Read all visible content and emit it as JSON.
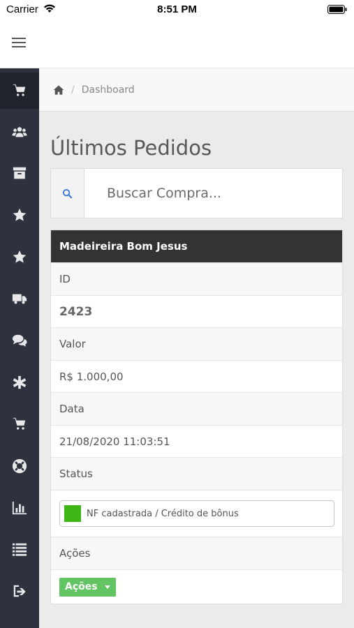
{
  "status_bar": {
    "carrier": "Carrier",
    "time": "8:51 PM"
  },
  "breadcrumb": {
    "separator": "/",
    "current": "Dashboard"
  },
  "page": {
    "title": "Últimos Pedidos"
  },
  "search": {
    "placeholder": "Buscar Compra..."
  },
  "order": {
    "company": "Madeireira Bom Jesus",
    "id_label": "ID",
    "id_value": "2423",
    "valor_label": "Valor",
    "valor_value": "R$ 1.000,00",
    "data_label": "Data",
    "data_value": "21/08/2020 11:03:51",
    "status_label": "Status",
    "status_value": "NF cadastrada / Crédito de bônus",
    "status_color": "#3fb618",
    "acoes_label": "Ações",
    "acoes_button": "Ações"
  },
  "sidebar": {
    "items": [
      {
        "icon": "cart-icon",
        "active": true
      },
      {
        "icon": "users-icon"
      },
      {
        "icon": "archive-icon"
      },
      {
        "icon": "star-icon"
      },
      {
        "icon": "star-icon"
      },
      {
        "icon": "truck-icon"
      },
      {
        "icon": "comments-icon"
      },
      {
        "icon": "asterisk-icon"
      },
      {
        "icon": "cart-icon"
      },
      {
        "icon": "life-ring-icon"
      },
      {
        "icon": "bar-chart-icon"
      },
      {
        "icon": "list-icon"
      },
      {
        "icon": "sign-out-icon"
      }
    ]
  },
  "colors": {
    "sidebar_bg": "#2d323e",
    "header_bg": "#333333",
    "accent_green": "#62c462"
  }
}
